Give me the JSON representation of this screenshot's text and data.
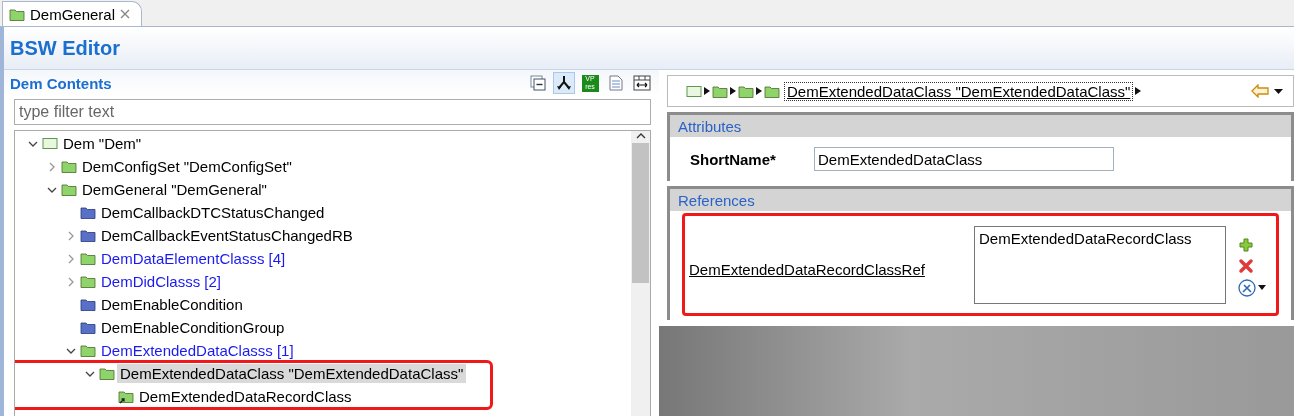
{
  "tab": {
    "label": "DemGeneral",
    "selected": true
  },
  "editor_title": "BSW Editor",
  "contents": {
    "title": "Dem Contents",
    "tools": [
      {
        "kind": "collapse",
        "selected": false
      },
      {
        "kind": "merge",
        "selected": true
      },
      {
        "kind": "badge",
        "lines": [
          "VP",
          "res"
        ],
        "selected": false
      },
      {
        "kind": "document",
        "selected": false
      },
      {
        "kind": "columns",
        "selected": false
      }
    ],
    "filter": {
      "placeholder": "type filter text"
    },
    "tree": [
      {
        "label": "Dem \"Dem\"",
        "kind": "root",
        "expanded": true,
        "selected": false,
        "children": [
          {
            "label": "DemConfigSet \"DemConfigSet\"",
            "kind": "folder",
            "expanded": false,
            "selected": false
          },
          {
            "label": "DemGeneral \"DemGeneral\"",
            "kind": "folder",
            "expanded": true,
            "selected": false,
            "children": [
              {
                "label": "DemCallbackDTCStatusChanged",
                "kind": "container",
                "selected": false
              },
              {
                "label": "DemCallbackEventStatusChangedRB",
                "kind": "container",
                "expanded": false,
                "selected": false
              },
              {
                "label": "DemDataElementClasss [4]",
                "kind": "folder",
                "list": true,
                "expanded": false,
                "selected": false
              },
              {
                "label": "DemDidClasss [2]",
                "kind": "folder",
                "list": true,
                "expanded": false,
                "selected": false
              },
              {
                "label": "DemEnableCondition",
                "kind": "container",
                "selected": false
              },
              {
                "label": "DemEnableConditionGroup",
                "kind": "container",
                "selected": false
              },
              {
                "label": "DemExtendedDataClasss [1]",
                "kind": "folder",
                "list": true,
                "expanded": true,
                "selected": false,
                "children": [
                  {
                    "label": "DemExtendedDataClass \"DemExtendedDataClass\"",
                    "kind": "folder",
                    "expanded": true,
                    "selected": true,
                    "annotated": true,
                    "children": [
                      {
                        "label": "DemExtendedDataRecordClass",
                        "kind": "reference",
                        "selected": false
                      }
                    ]
                  }
                ]
              }
            ]
          }
        ]
      }
    ]
  },
  "breadcrumb": {
    "path": [
      {
        "kind": "root"
      },
      {
        "kind": "folder"
      },
      {
        "kind": "folder"
      },
      {
        "kind": "folder"
      }
    ],
    "current": "DemExtendedDataClass \"DemExtendedDataClass\""
  },
  "attributes": {
    "title": "Attributes",
    "fields": [
      {
        "label": "ShortName*",
        "value": "DemExtendedDataClass"
      }
    ]
  },
  "references": {
    "title": "References",
    "items": [
      {
        "label": "DemExtendedDataRecordClassRef",
        "values": [
          "DemExtendedDataRecordClass"
        ],
        "annotated": true
      }
    ]
  }
}
